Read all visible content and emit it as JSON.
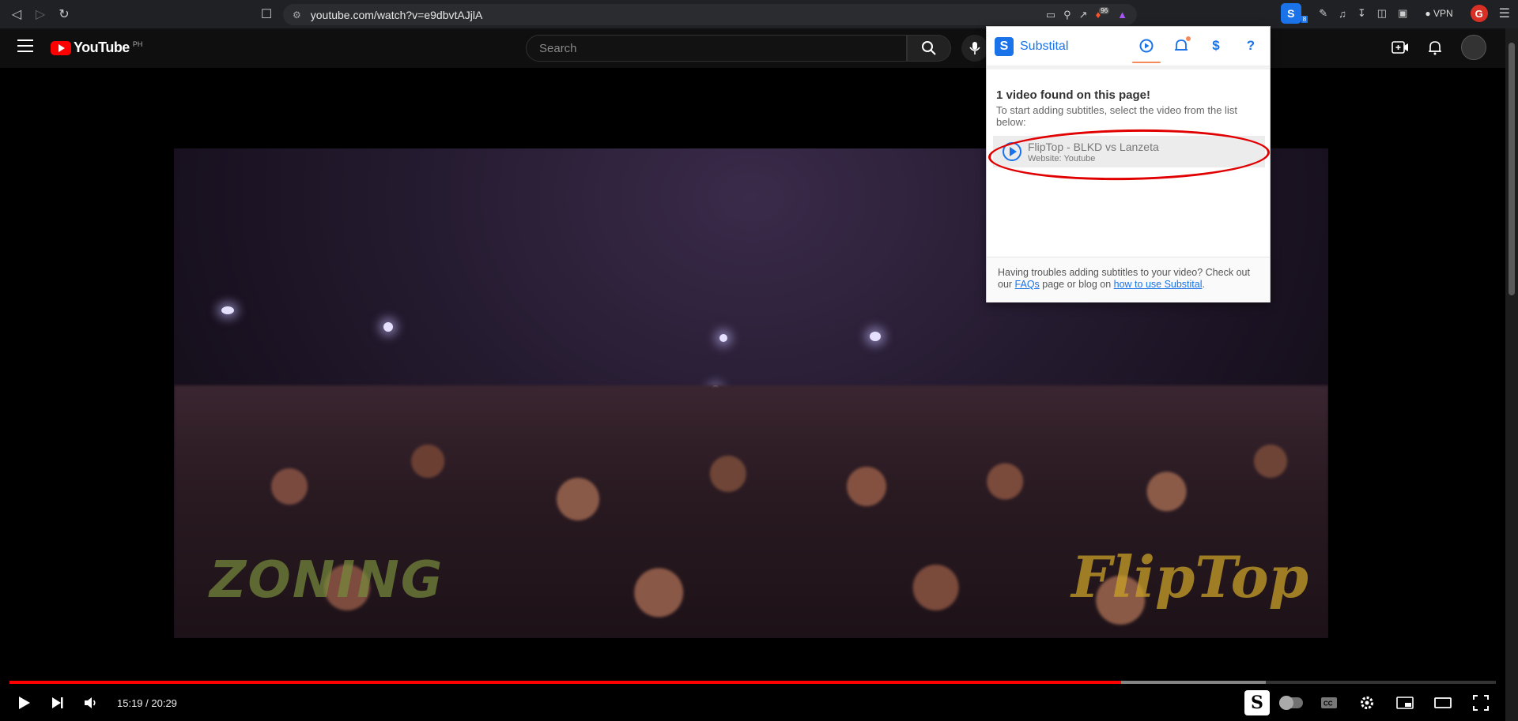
{
  "browser": {
    "url": "youtube.com/watch?v=e9dbvtAJjlA",
    "vpn_label": "VPN",
    "ext_badge": "8",
    "brave_badge": "96"
  },
  "youtube": {
    "logo_text": "YouTube",
    "country": "PH",
    "search_placeholder": "Search"
  },
  "video": {
    "watermark_left": "ZONING",
    "watermark_right": "FlipTop",
    "time_current": "15:19",
    "time_total": "20:29",
    "time_display": "15:19 / 20:29",
    "progress_fraction": 0.748,
    "buffered_fraction": 0.845
  },
  "substital": {
    "title": "Substital",
    "found_text": "1 video found on this page!",
    "hint_text": "To start adding subtitles, select the video from the list below:",
    "video_title": "FlipTop - BLKD vs Lanzeta",
    "video_site": "Website: Youtube",
    "footer_prefix": "Having troubles adding subtitles to your video? Check out our ",
    "faq_link": "FAQs",
    "footer_mid": " page or blog on ",
    "howto_link": "how to use Substital",
    "footer_suffix": ".",
    "accent_color": "#1a73e8",
    "annotation_color": "#e10000"
  }
}
